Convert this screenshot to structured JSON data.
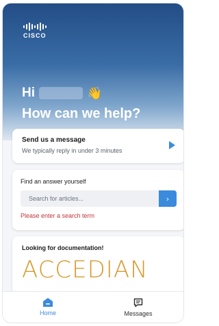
{
  "brand": {
    "logo_text": "CISCO"
  },
  "hero": {
    "greeting": "Hi",
    "wave_emoji": "👋",
    "headline": "How can we help?"
  },
  "message_card": {
    "title": "Send us a message",
    "subtitle": "We typically reply in under 3 minutes",
    "arrow_icon": "play-arrow-icon"
  },
  "find_card": {
    "title": "Find an answer yourself",
    "search_placeholder": "Search for articles...",
    "search_button_glyph": "›",
    "error": "Please enter a search term"
  },
  "doc_card": {
    "title": "Looking for documentation!",
    "logo_text": "ACCEDIAN"
  },
  "nav": {
    "home_label": "Home",
    "messages_label": "Messages"
  },
  "colors": {
    "accent": "#3b8bdc",
    "error": "#c0343a",
    "doc_logo": "#d89a2e"
  }
}
